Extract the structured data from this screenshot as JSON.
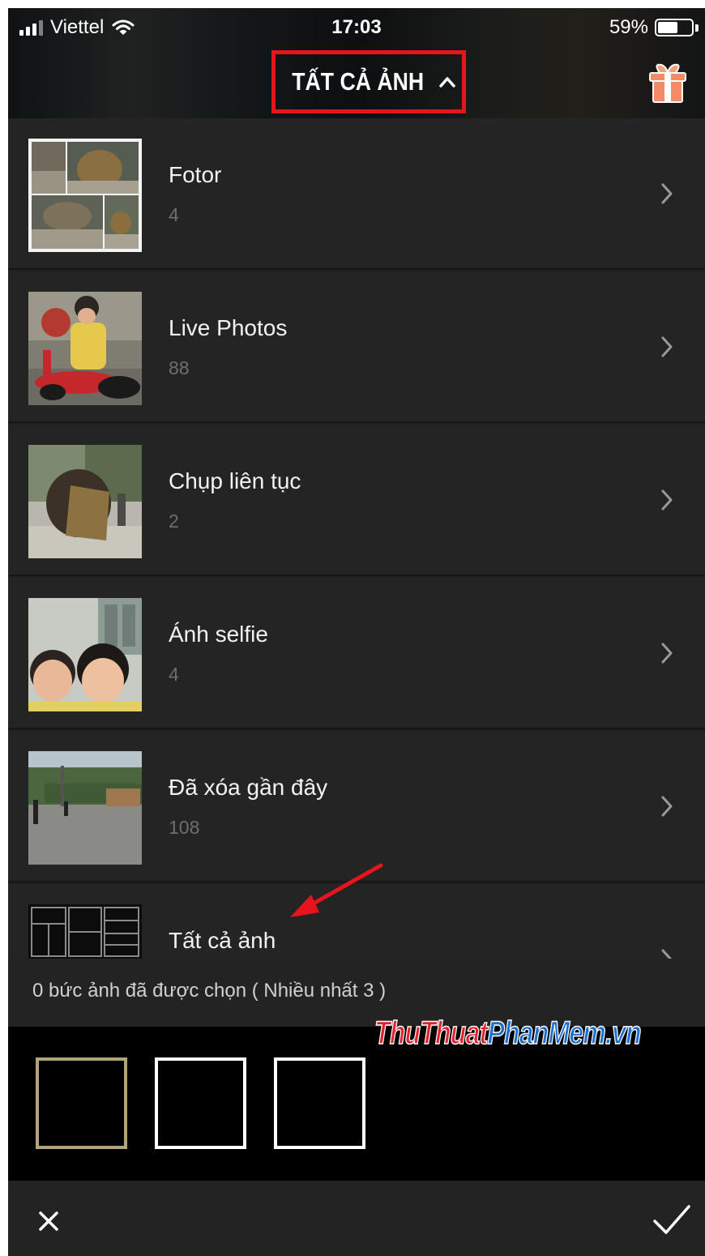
{
  "status_bar": {
    "carrier": "Viettel",
    "time": "17:03",
    "battery_percent": "59%",
    "battery_level": 0.59
  },
  "header": {
    "album_title": "TẤT CẢ ẢNH",
    "gift_icon": "gift-icon",
    "highlight_color": "#e8141c"
  },
  "albums": [
    {
      "name": "Fotor",
      "count": "4",
      "thumb": "stone-collage"
    },
    {
      "name": "Live Photos",
      "count": "88",
      "thumb": "child-toy"
    },
    {
      "name": "Chụp liên tục",
      "count": "2",
      "thumb": "stone-monument"
    },
    {
      "name": "Ánh selfie",
      "count": "4",
      "thumb": "children-selfie"
    },
    {
      "name": "Đã xóa gần đây",
      "count": "108",
      "thumb": "street-scene"
    },
    {
      "name": "Tất cả ảnh",
      "count": "",
      "thumb": "grid-pattern"
    }
  ],
  "selection": {
    "selected_text": "0 bức ảnh đã được chọn ( Nhiều nhất 3 )",
    "slot_count": 3,
    "active_slot_color": "#b3a27a"
  },
  "watermark": {
    "part1": "ThuThuat",
    "part2": "PhanMem.vn"
  },
  "toolbar": {
    "close_icon": "close-icon",
    "confirm_icon": "checkmark-icon"
  }
}
